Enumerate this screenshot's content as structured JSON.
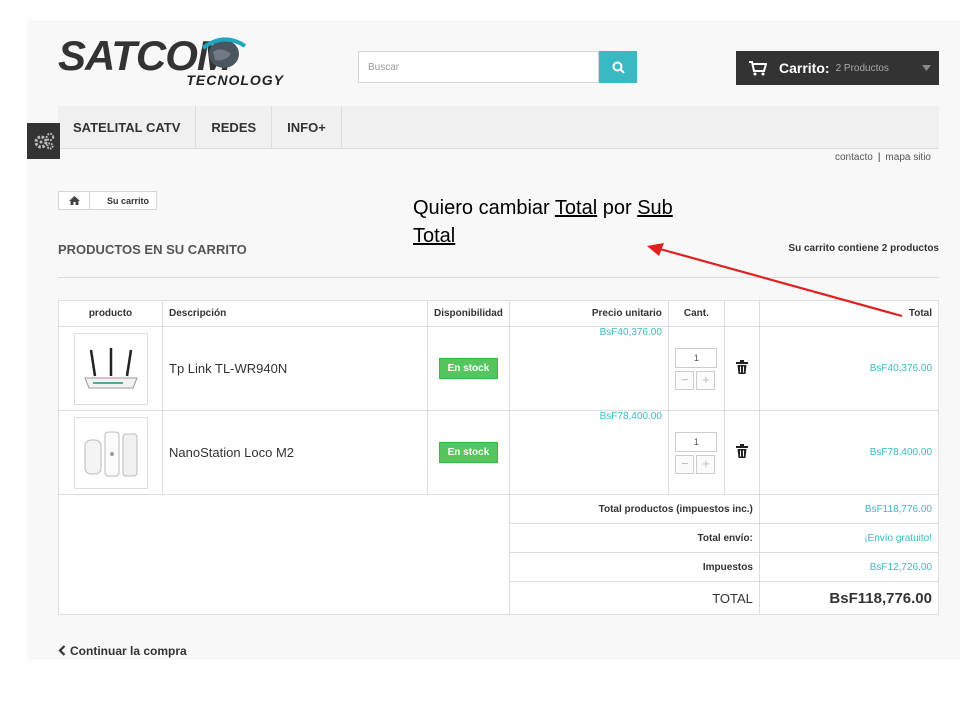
{
  "logo": {
    "main": "SATCOM",
    "sub": "TECNOLOGY"
  },
  "search": {
    "placeholder": "Buscar"
  },
  "cart": {
    "label": "Carrito:",
    "count": "2 Productos"
  },
  "menu": {
    "items": [
      {
        "label": "SATELITAL CATV"
      },
      {
        "label": "REDES"
      },
      {
        "label": "INFO+"
      }
    ]
  },
  "toplinks": {
    "contact": "contacto",
    "separator": "|",
    "sitemap": "mapa sitio"
  },
  "breadcrumb": {
    "current": "Su carrito"
  },
  "page": {
    "title": "PRODUCTOS EN SU CARRITO",
    "summary": "Su carrito contiene 2 productos"
  },
  "annotation": {
    "text_before": "Quiero cambiar ",
    "word_total": "Total",
    "text_mid": " por ",
    "word_sub": "Sub",
    "word_total2": "Total"
  },
  "table": {
    "headers": {
      "product": "producto",
      "description": "Descripción",
      "availability": "Disponibilidad",
      "unit_price": "Precio unitario",
      "qty": "Cant.",
      "total": "Total"
    },
    "rows": [
      {
        "description": "Tp Link TL-WR940N",
        "stock": "En stock",
        "unit_price": "BsF40,376.00",
        "qty": "1",
        "total": "BsF40,376.00"
      },
      {
        "description": "NanoStation Loco M2",
        "stock": "En stock",
        "unit_price": "BsF78,400.00",
        "qty": "1",
        "total": "BsF78,400.00"
      }
    ],
    "summary": {
      "products_label": "Total productos (impuestos inc.)",
      "products_value": "BsF118,776.00",
      "shipping_label": "Total envío:",
      "shipping_value": "¡Envío gratuito!",
      "tax_label": "Impuestos",
      "tax_value": "BsF12,726.00",
      "grand_label": "TOTAL",
      "grand_value": "BsF118,776.00"
    }
  },
  "continue": {
    "label": "Continuar la compra"
  },
  "colors": {
    "accent": "#3bb9c3",
    "stock": "#55c65e",
    "dark": "#333333",
    "arrow": "#e02020"
  }
}
